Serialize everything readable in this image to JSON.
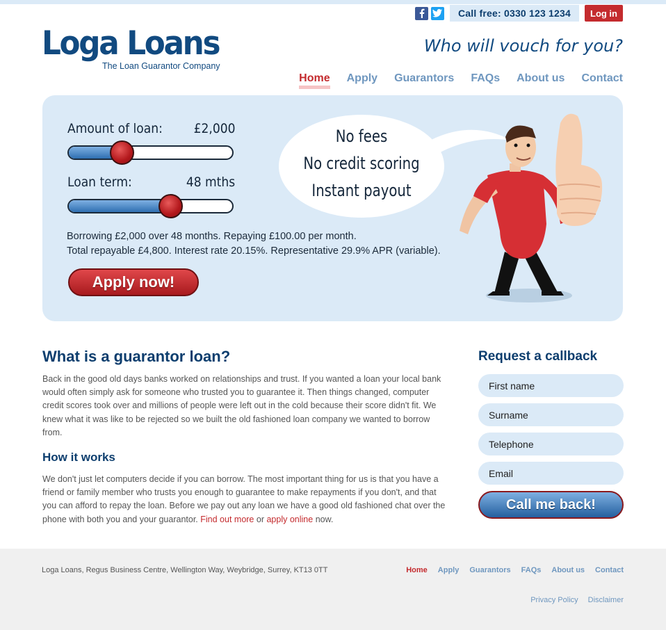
{
  "header": {
    "phone": "Call free: 0330 123 1234",
    "login_label": "Log in",
    "logo_name": "Loga Loans",
    "logo_tagline": "The Loan Guarantor Company",
    "slogan": "Who will vouch for you?",
    "social_icons": [
      "facebook-icon",
      "twitter-icon"
    ],
    "nav": [
      {
        "label": "Home",
        "active": true
      },
      {
        "label": "Apply"
      },
      {
        "label": "Guarantors"
      },
      {
        "label": "FAQs"
      },
      {
        "label": "About us"
      },
      {
        "label": "Contact"
      }
    ]
  },
  "calculator": {
    "amount_label": "Amount of loan:",
    "amount_value": "£2,000",
    "amount_fraction": 0.33,
    "term_label": "Loan term:",
    "term_value": "48 mths",
    "term_fraction": 0.62,
    "summary_line1": "Borrowing £2,000 over 48 months. Repaying £100.00 per month.",
    "summary_line2": "Total repayable £4,800. Interest rate 20.15%. Representative 29.9% APR (variable).",
    "apply_label": "Apply now!"
  },
  "bubble": {
    "line1": "No fees",
    "line2": "No credit scoring",
    "line3": "Instant payout"
  },
  "content": {
    "heading": "What is a guarantor loan?",
    "para1": "Back in the good old days banks worked on relationships and trust. If you wanted a loan your local bank would often simply ask for someone who trusted you to guarantee it. Then things changed, computer credit scores took over and millions of people were left out in the cold because their score didn't fit. We knew what it was like to be rejected so we built the old fashioned loan company we wanted to borrow from.",
    "subheading": "How it works",
    "para2": "We don't just let computers decide if you can borrow. The most important thing for us is that you have a friend or family member who trusts you enough to guarantee to make repayments if you don't, and that you can afford to repay the loan. Before we pay out any loan we have a good old fashioned chat over the phone with both you and your guarantor.",
    "link1": "Find out more",
    "or_text": "or",
    "link2": "apply online",
    "tail": "now."
  },
  "callback": {
    "heading": "Request a callback",
    "first_name": "First name",
    "surname": "Surname",
    "telephone": "Telephone",
    "email": "Email",
    "button": "Call me back!"
  },
  "footer": {
    "address": "Loga Loans, Regus Business Centre, Wellington Way, Weybridge, Surrey, KT13 0TT",
    "nav": [
      {
        "label": "Home",
        "active": true
      },
      {
        "label": "Apply"
      },
      {
        "label": "Guarantors"
      },
      {
        "label": "FAQs"
      },
      {
        "label": "About us"
      },
      {
        "label": "Contact"
      }
    ],
    "privacy": "Privacy Policy",
    "disclaimer": "Disclaimer"
  },
  "colors": {
    "brand_blue": "#114a80",
    "accent_red": "#c42b2e",
    "light_blue": "#dbeaf7",
    "nav_blue": "#6f97bf"
  }
}
